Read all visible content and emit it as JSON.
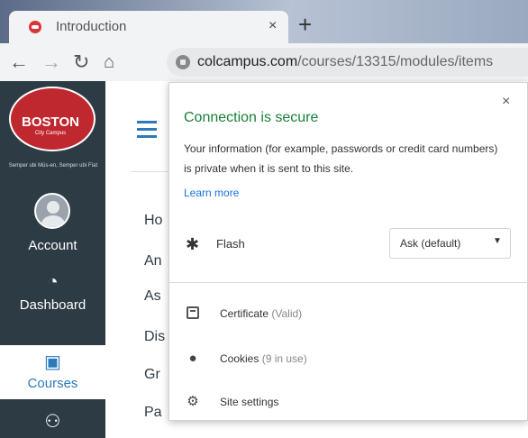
{
  "browser": {
    "tab_title": "Introduction",
    "tab_close": "×",
    "new_tab": "+",
    "url_domain": "colcampus.com",
    "url_path": "/courses/13315/modules/items"
  },
  "sidebar": {
    "logo_text": "BOSTON",
    "logo_sub": "City Campus",
    "motto": "Semper ubi Mūs-en, Semper ubi Fīat",
    "items": [
      {
        "label": "Account",
        "icon": "avatar"
      },
      {
        "label": "Dashboard",
        "icon": "dashboard-icon"
      },
      {
        "label": "Courses",
        "icon": "courses-icon"
      },
      {
        "label": "",
        "icon": "groups-icon"
      }
    ]
  },
  "course_nav": [
    "Ho",
    "An",
    "As",
    "Dis",
    "Gr",
    "Pa"
  ],
  "popup": {
    "title": "Connection is secure",
    "close": "×",
    "description": "Your information (for example, passwords or credit card numbers) is private when it is sent to this site.",
    "learn_more": "Learn more",
    "flash_label": "Flash",
    "flash_value": "Ask (default)",
    "certificate_label": "Certificate",
    "certificate_status": "(Valid)",
    "cookies_label": "Cookies",
    "cookies_status": "(9 in use)",
    "site_settings_label": "Site settings"
  },
  "colors": {
    "secure_green": "#188038",
    "link_blue": "#1a73e8",
    "sidebar_bg": "#2d3b45",
    "brand_red": "#c0282f"
  }
}
